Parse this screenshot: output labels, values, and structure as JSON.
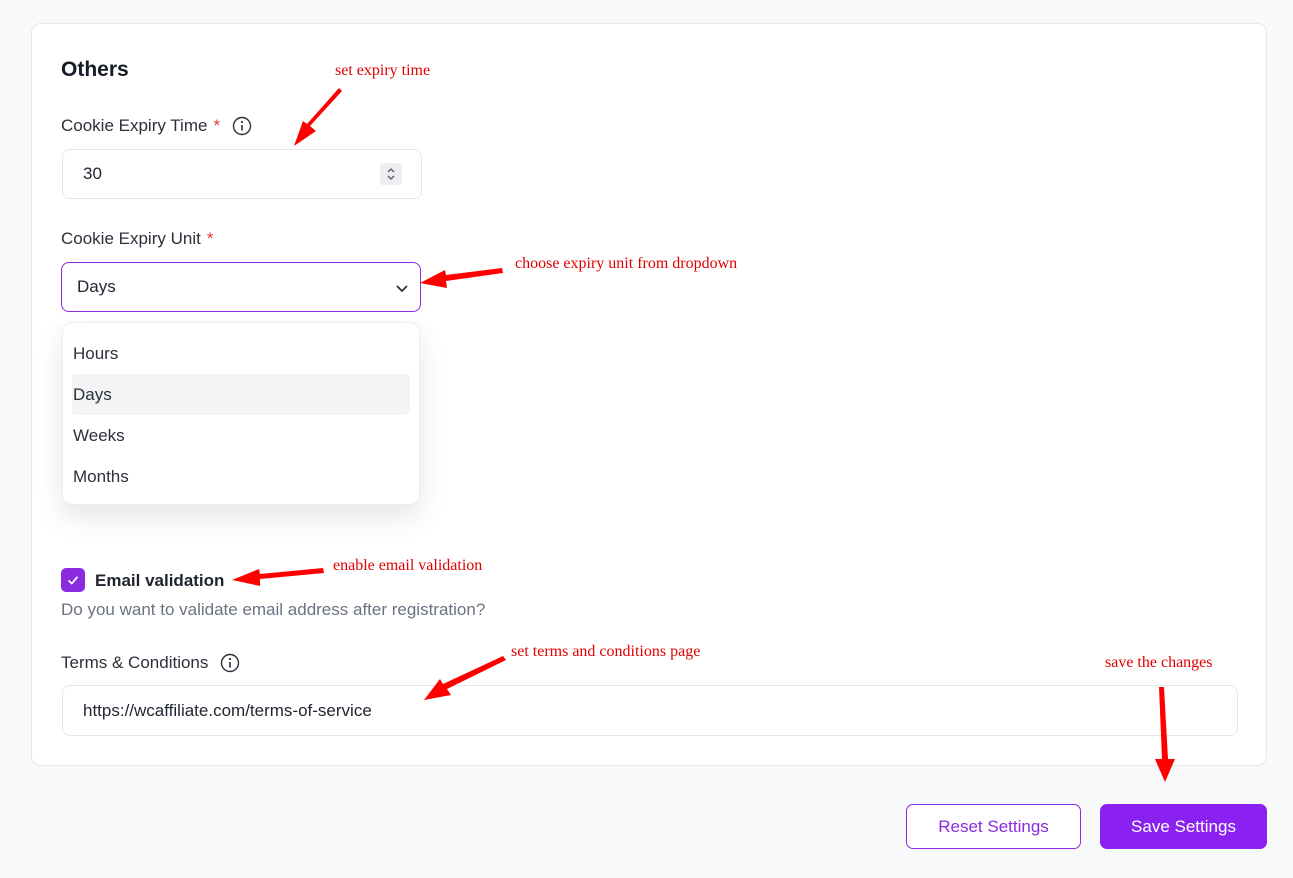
{
  "section": {
    "title": "Others"
  },
  "cookie_time": {
    "label": "Cookie Expiry Time",
    "required_mark": "*",
    "value": "30"
  },
  "cookie_unit": {
    "label": "Cookie Expiry Unit",
    "required_mark": "*",
    "selected": "Days",
    "options": [
      "Hours",
      "Days",
      "Weeks",
      "Months"
    ]
  },
  "email_validation": {
    "label": "Email validation",
    "checked": true,
    "helper": "Do you want to validate email address after registration?"
  },
  "terms": {
    "label": "Terms & Conditions",
    "value": "https://wcaffiliate.com/terms-of-service"
  },
  "buttons": {
    "reset": "Reset Settings",
    "save": "Save Settings"
  },
  "annotations": {
    "expiry_time": "set expiry time",
    "expiry_unit": "choose expiry unit from dropdown",
    "email_validation": "enable email validation",
    "terms": "set terms and conditions page",
    "save": "save the changes"
  },
  "colors": {
    "accent": "#8a2be2",
    "required": "#e53935",
    "annotation": "#e00000"
  }
}
